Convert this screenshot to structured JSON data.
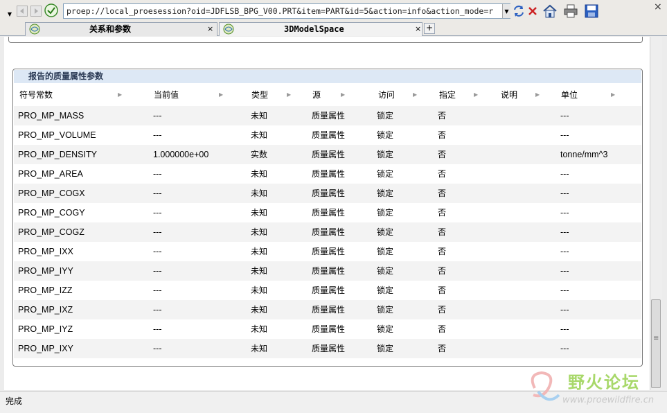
{
  "toolbar": {
    "url": "proep://local_proesession?oid=JDFLSB_BPG_V00.PRT&item=PART&id=5&action=info&action_mode=r"
  },
  "tabs": [
    {
      "label": "关系和参数",
      "close": "×"
    },
    {
      "label": "3DModelSpace",
      "close": "×"
    }
  ],
  "tab_add": "+",
  "panel": {
    "title": "报告的质量属性参数",
    "columns": [
      "符号常数",
      "当前值",
      "类型",
      "源",
      "访问",
      "指定",
      "说明",
      "单位"
    ],
    "rows": [
      {
        "name": "PRO_MP_MASS",
        "value": "---",
        "type": "未知",
        "source": "质量属性",
        "access": "锁定",
        "designated": "否",
        "desc": "",
        "unit": "---"
      },
      {
        "name": "PRO_MP_VOLUME",
        "value": "---",
        "type": "未知",
        "source": "质量属性",
        "access": "锁定",
        "designated": "否",
        "desc": "",
        "unit": "---"
      },
      {
        "name": "PRO_MP_DENSITY",
        "value": "1.000000e+00",
        "type": "实数",
        "source": "质量属性",
        "access": "锁定",
        "designated": "否",
        "desc": "",
        "unit": "tonne/mm^3"
      },
      {
        "name": "PRO_MP_AREA",
        "value": "---",
        "type": "未知",
        "source": "质量属性",
        "access": "锁定",
        "designated": "否",
        "desc": "",
        "unit": "---"
      },
      {
        "name": "PRO_MP_COGX",
        "value": "---",
        "type": "未知",
        "source": "质量属性",
        "access": "锁定",
        "designated": "否",
        "desc": "",
        "unit": "---"
      },
      {
        "name": "PRO_MP_COGY",
        "value": "---",
        "type": "未知",
        "source": "质量属性",
        "access": "锁定",
        "designated": "否",
        "desc": "",
        "unit": "---"
      },
      {
        "name": "PRO_MP_COGZ",
        "value": "---",
        "type": "未知",
        "source": "质量属性",
        "access": "锁定",
        "designated": "否",
        "desc": "",
        "unit": "---"
      },
      {
        "name": "PRO_MP_IXX",
        "value": "---",
        "type": "未知",
        "source": "质量属性",
        "access": "锁定",
        "designated": "否",
        "desc": "",
        "unit": "---"
      },
      {
        "name": "PRO_MP_IYY",
        "value": "---",
        "type": "未知",
        "source": "质量属性",
        "access": "锁定",
        "designated": "否",
        "desc": "",
        "unit": "---"
      },
      {
        "name": "PRO_MP_IZZ",
        "value": "---",
        "type": "未知",
        "source": "质量属性",
        "access": "锁定",
        "designated": "否",
        "desc": "",
        "unit": "---"
      },
      {
        "name": "PRO_MP_IXZ",
        "value": "---",
        "type": "未知",
        "source": "质量属性",
        "access": "锁定",
        "designated": "否",
        "desc": "",
        "unit": "---"
      },
      {
        "name": "PRO_MP_IYZ",
        "value": "---",
        "type": "未知",
        "source": "质量属性",
        "access": "锁定",
        "designated": "否",
        "desc": "",
        "unit": "---"
      },
      {
        "name": "PRO_MP_IXY",
        "value": "---",
        "type": "未知",
        "source": "质量属性",
        "access": "锁定",
        "designated": "否",
        "desc": "",
        "unit": "---"
      }
    ]
  },
  "status": {
    "text": "完成"
  },
  "watermark": {
    "text": "野火论坛",
    "url": "www.proewildfire.cn"
  },
  "icons": {
    "back": "back-arrow-icon",
    "forward": "forward-arrow-icon",
    "refresh": "refresh-icon",
    "stop": "stop-icon",
    "home": "home-icon",
    "print": "printer-icon",
    "save": "save-disk-icon",
    "tab": "tab-globe-icon"
  },
  "colors": {
    "panel_title_bg": "#dde8f5",
    "alt_row": "#f3f3f3",
    "stop": "#cc2222",
    "save": "#2a5fc1"
  }
}
